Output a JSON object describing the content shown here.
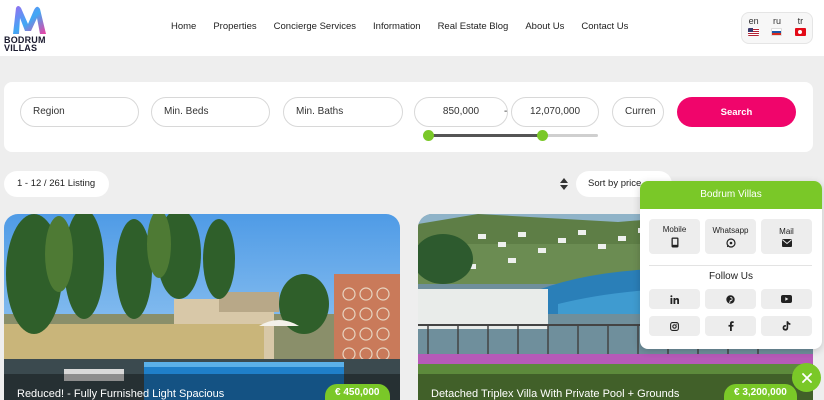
{
  "brand": {
    "line1": "BODRUM",
    "line2": "VILLAS"
  },
  "nav": [
    "Home",
    "Properties",
    "Concierge Services",
    "Information",
    "Real Estate Blog",
    "About Us",
    "Contact Us"
  ],
  "languages": [
    {
      "code": "en",
      "flag": "uk-flag-icon"
    },
    {
      "code": "ru",
      "flag": "russia-flag-icon"
    },
    {
      "code": "tr",
      "flag": "turkey-flag-icon"
    }
  ],
  "search": {
    "region": "Region",
    "beds": "Min. Beds",
    "baths": "Min. Baths",
    "price_min": "850,000",
    "price_max": "12,070,000",
    "currency": "Curren",
    "button": "Search",
    "range_fraction": [
      0.02,
      0.68
    ]
  },
  "listing": {
    "count": "1 - 12 / 261 Listing",
    "sort": "Sort by price"
  },
  "cards": [
    {
      "title": "Reduced! - Fully Furnished Light Spacious",
      "price": "€ 450,000"
    },
    {
      "title": "Detached Triplex Villa With Private Pool + Grounds",
      "price": "€ 3,200,000"
    }
  ],
  "widget": {
    "title": "Bodrum Villas",
    "contact": [
      {
        "label": "Mobile",
        "icon": "phone-icon"
      },
      {
        "label": "Whatsapp",
        "icon": "whatsapp-icon"
      },
      {
        "label": "Mail",
        "icon": "mail-icon"
      }
    ],
    "follow_title": "Follow Us",
    "social": [
      "linkedin-icon",
      "pinterest-icon",
      "youtube-icon",
      "instagram-icon",
      "facebook-icon",
      "tiktok-icon"
    ]
  },
  "colors": {
    "accent_green": "#7ac828",
    "search_pink": "#f0056b",
    "background": "#eeeeee"
  }
}
